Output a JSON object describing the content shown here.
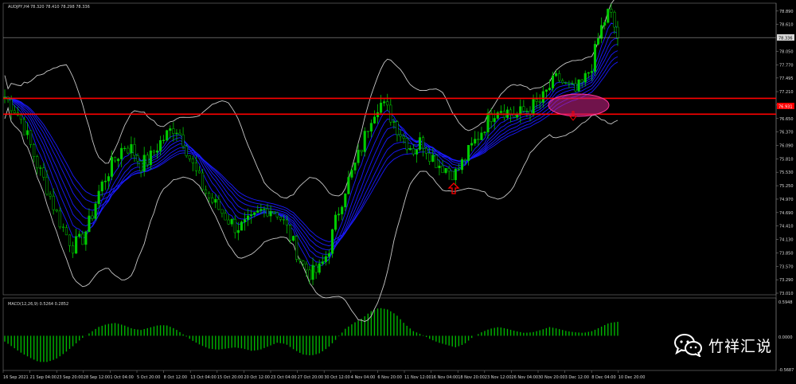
{
  "window": {
    "symbol_header": "AUDJPY,H4",
    "ohlc_header": "78.320 78.410 78.298 78.336"
  },
  "price_axis": {
    "labels": [
      "78.890",
      "78.610",
      "78.050",
      "77.770",
      "77.495",
      "77.210",
      "76.931",
      "76.650",
      "76.370",
      "76.090",
      "75.810",
      "75.530",
      "75.250",
      "74.970",
      "74.690",
      "74.410",
      "74.130",
      "73.850",
      "73.570",
      "73.290",
      "73.010"
    ],
    "current_price": "78.336",
    "line_price": "76.931"
  },
  "macd": {
    "header": "MACD(12,26,9) 0.5264 0.2852",
    "scale_top": "0.5948",
    "scale_zero": "0.0000",
    "scale_bottom": "-0.5687"
  },
  "time_axis": {
    "labels": [
      "16 Sep 2021",
      "21 Sep 04:00",
      "23 Sep 20:00",
      "28 Sep 12:00",
      "1 Oct 04:00",
      "5 Oct 20:00",
      "8 Oct 12:00",
      "13 Oct 04:00",
      "15 Oct 20:00",
      "20 Oct 12:00",
      "23 Oct 04:00",
      "27 Oct 20:00",
      "30 Oct 12:00",
      "4 Nov 04:00",
      "6 Nov 20:00",
      "11 Nov 12:00",
      "16 Nov 04:00",
      "18 Nov 20:00",
      "23 Nov 12:00",
      "26 Nov 04:00",
      "30 Nov 20:00",
      "3 Dec 12:00",
      "8 Dec 04:00",
      "10 Dec 20:00"
    ]
  },
  "watermark": {
    "text": "竹祥汇说",
    "icon": "wechat-icon"
  },
  "colors": {
    "background": "#000000",
    "candle": "#00cc00",
    "ma_fan": "#1a1aff",
    "bollinger": "#c8c8c8",
    "resistance_lines": "#ff0000",
    "highlight_ellipse": "#cc2288",
    "arrow": "#ff0000",
    "macd_histogram": "#00b400"
  },
  "chart_data": {
    "type": "line",
    "symbol": "AUDJPY",
    "timeframe": "H4",
    "x_labels": [
      "16 Sep 2021",
      "21 Sep 04:00",
      "23 Sep 20:00",
      "28 Sep 12:00",
      "1 Oct 04:00",
      "5 Oct 20:00",
      "8 Oct 12:00",
      "13 Oct 04:00",
      "15 Oct 20:00",
      "20 Oct 12:00",
      "23 Oct 04:00",
      "27 Oct 20:00",
      "30 Oct 12:00",
      "4 Nov 04:00",
      "6 Nov 20:00",
      "11 Nov 12:00",
      "16 Nov 04:00",
      "18 Nov 20:00",
      "23 Nov 12:00",
      "26 Nov 04:00",
      "30 Nov 20:00",
      "3 Dec 12:00",
      "8 Dec 04:00",
      "10 Dec 20:00"
    ],
    "ylim": [
      73.01,
      79.02
    ],
    "series": [
      {
        "values": [
          77.1,
          76.9,
          76.6,
          76.1,
          75.6,
          75.2,
          74.7,
          74.3,
          74.0,
          74.1,
          74.5,
          75.1,
          75.5,
          75.8,
          76.1,
          76.0,
          75.7,
          75.8,
          76.1,
          76.3,
          76.5,
          76.2,
          75.7,
          75.3,
          75.0,
          74.8,
          74.6,
          74.4,
          74.4,
          74.5,
          74.7,
          74.8,
          74.7,
          74.4,
          74.0,
          73.6,
          73.4,
          73.5,
          73.9,
          74.6,
          75.2,
          75.6,
          76.1,
          76.7,
          77.0,
          76.8,
          76.5,
          76.2,
          76.0,
          76.2,
          75.9,
          75.7,
          75.6,
          75.5,
          75.8,
          76.1,
          76.4,
          76.7,
          76.9,
          76.8,
          76.7,
          76.8,
          76.9,
          77.0,
          77.3,
          77.5,
          77.3,
          77.2,
          77.4,
          77.8,
          78.5,
          78.9,
          78.34
        ]
      }
    ],
    "horizontal_lines": [
      77.07,
      76.74
    ],
    "macd": {
      "ylim": [
        -0.5687,
        0.5948
      ],
      "values": [
        -0.1,
        -0.2,
        -0.3,
        -0.38,
        -0.45,
        -0.45,
        -0.4,
        -0.3,
        -0.18,
        -0.05,
        0.05,
        0.15,
        0.2,
        0.22,
        0.18,
        0.12,
        0.1,
        0.14,
        0.18,
        0.18,
        0.12,
        0.02,
        -0.08,
        -0.16,
        -0.22,
        -0.24,
        -0.22,
        -0.2,
        -0.22,
        -0.26,
        -0.24,
        -0.18,
        -0.12,
        -0.14,
        -0.24,
        -0.32,
        -0.34,
        -0.3,
        -0.2,
        -0.05,
        0.12,
        0.22,
        0.3,
        0.42,
        0.48,
        0.45,
        0.36,
        0.2,
        0.08,
        0.02,
        -0.06,
        -0.12,
        -0.16,
        -0.2,
        -0.14,
        -0.02,
        0.06,
        0.12,
        0.15,
        0.12,
        0.08,
        0.05,
        0.06,
        0.1,
        0.15,
        0.12,
        0.08,
        0.06,
        0.05,
        0.08,
        0.15,
        0.22,
        0.24
      ]
    }
  }
}
